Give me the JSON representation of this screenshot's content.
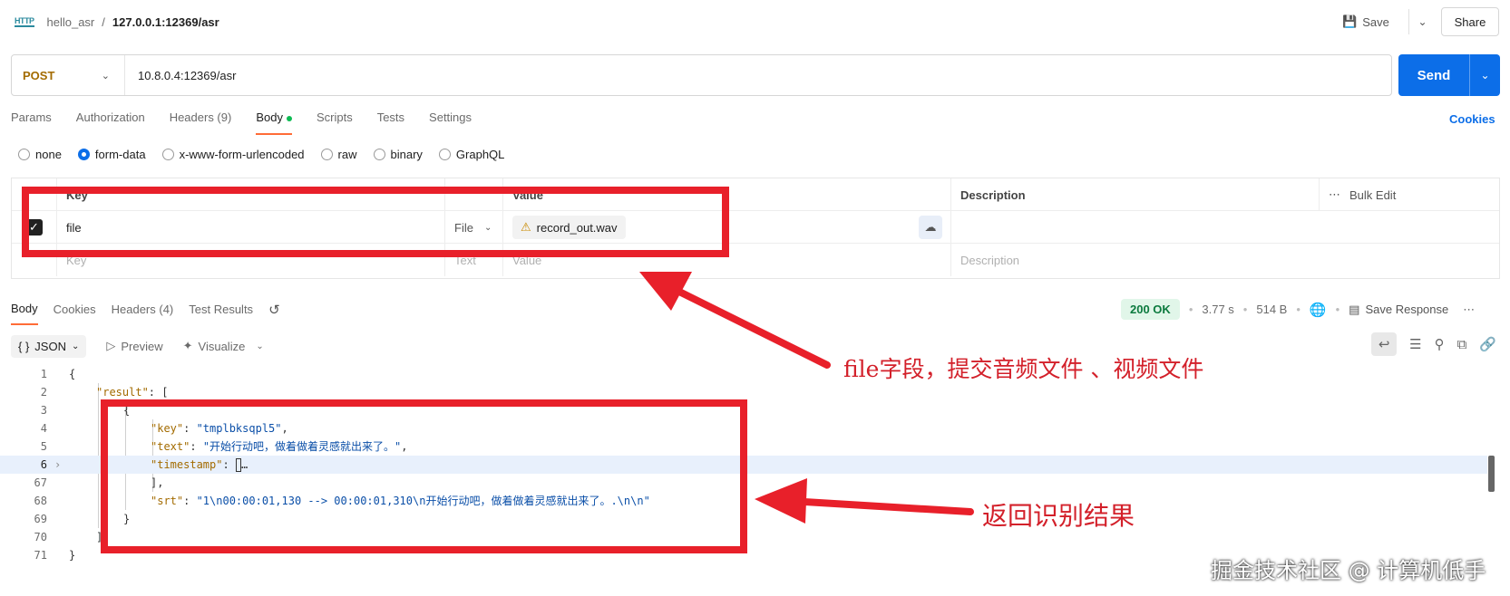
{
  "breadcrumb": {
    "icon": "HTTP",
    "collection": "hello_asr",
    "separator": "/",
    "request": "127.0.0.1:12369/asr"
  },
  "header": {
    "save_label": "Save",
    "share_label": "Share"
  },
  "request": {
    "method": "POST",
    "url": "10.8.0.4:12369/asr",
    "send_label": "Send"
  },
  "req_tabs": [
    {
      "label": "Params"
    },
    {
      "label": "Authorization"
    },
    {
      "label": "Headers (9)"
    },
    {
      "label": "Body"
    },
    {
      "label": "Scripts"
    },
    {
      "label": "Tests"
    },
    {
      "label": "Settings"
    }
  ],
  "cookies_link": "Cookies",
  "body_types": [
    {
      "label": "none",
      "selected": false
    },
    {
      "label": "form-data",
      "selected": true
    },
    {
      "label": "x-www-form-urlencoded",
      "selected": false
    },
    {
      "label": "raw",
      "selected": false
    },
    {
      "label": "binary",
      "selected": false
    },
    {
      "label": "GraphQL",
      "selected": false
    }
  ],
  "form_table": {
    "headers": {
      "key": "Key",
      "value": "Value",
      "description": "Description",
      "bulk_edit": "Bulk Edit"
    },
    "rows": [
      {
        "key": "file",
        "type": "File",
        "file_name": "record_out.wav",
        "description": ""
      }
    ],
    "placeholder": {
      "key": "Key",
      "type": "Text",
      "value": "Value",
      "description": "Description"
    }
  },
  "resp_tabs": [
    {
      "label": "Body"
    },
    {
      "label": "Cookies"
    },
    {
      "label": "Headers (4)"
    },
    {
      "label": "Test Results"
    }
  ],
  "response_meta": {
    "status": "200 OK",
    "time": "3.77 s",
    "size": "514 B",
    "save_response": "Save Response"
  },
  "viewer": {
    "format": "JSON",
    "preview": "Preview",
    "visualize": "Visualize"
  },
  "code_lines": [
    {
      "n": "1",
      "text": "{"
    },
    {
      "n": "2",
      "key": "\"result\"",
      "after": ": ["
    },
    {
      "n": "3",
      "text": "{"
    },
    {
      "n": "4",
      "key": "\"key\"",
      "after": ": ",
      "value": "\"tmplbksqpl5\"",
      "tail": ","
    },
    {
      "n": "5",
      "key": "\"text\"",
      "after": ": ",
      "value": "\"开始行动吧，做着做着灵感就出来了。\"",
      "tail": ","
    },
    {
      "n": "6",
      "key": "\"timestamp\"",
      "after": ": ",
      "tail": "…"
    },
    {
      "n": "67",
      "text": "],"
    },
    {
      "n": "68",
      "key": "\"srt\"",
      "after": ": ",
      "value": "\"1\\n00:00:01,130 --> 00:00:01,310\\n开始行动吧，做着做着灵感就出来了。.\\n\\n\""
    },
    {
      "n": "69",
      "text": "}"
    },
    {
      "n": "70",
      "text": "]"
    },
    {
      "n": "71",
      "text": "}"
    }
  ],
  "annotations": {
    "file_note": "file字段，提交音频文件 、视频文件",
    "result_note": "返回识别结果"
  },
  "watermark": "掘金技术社区 @ 计算机低手",
  "colors": {
    "annotation_red": "#e8202a",
    "send_blue": "#0c6ee8",
    "tab_accent": "#ff6c37",
    "status_green": "#0c7a3e"
  }
}
